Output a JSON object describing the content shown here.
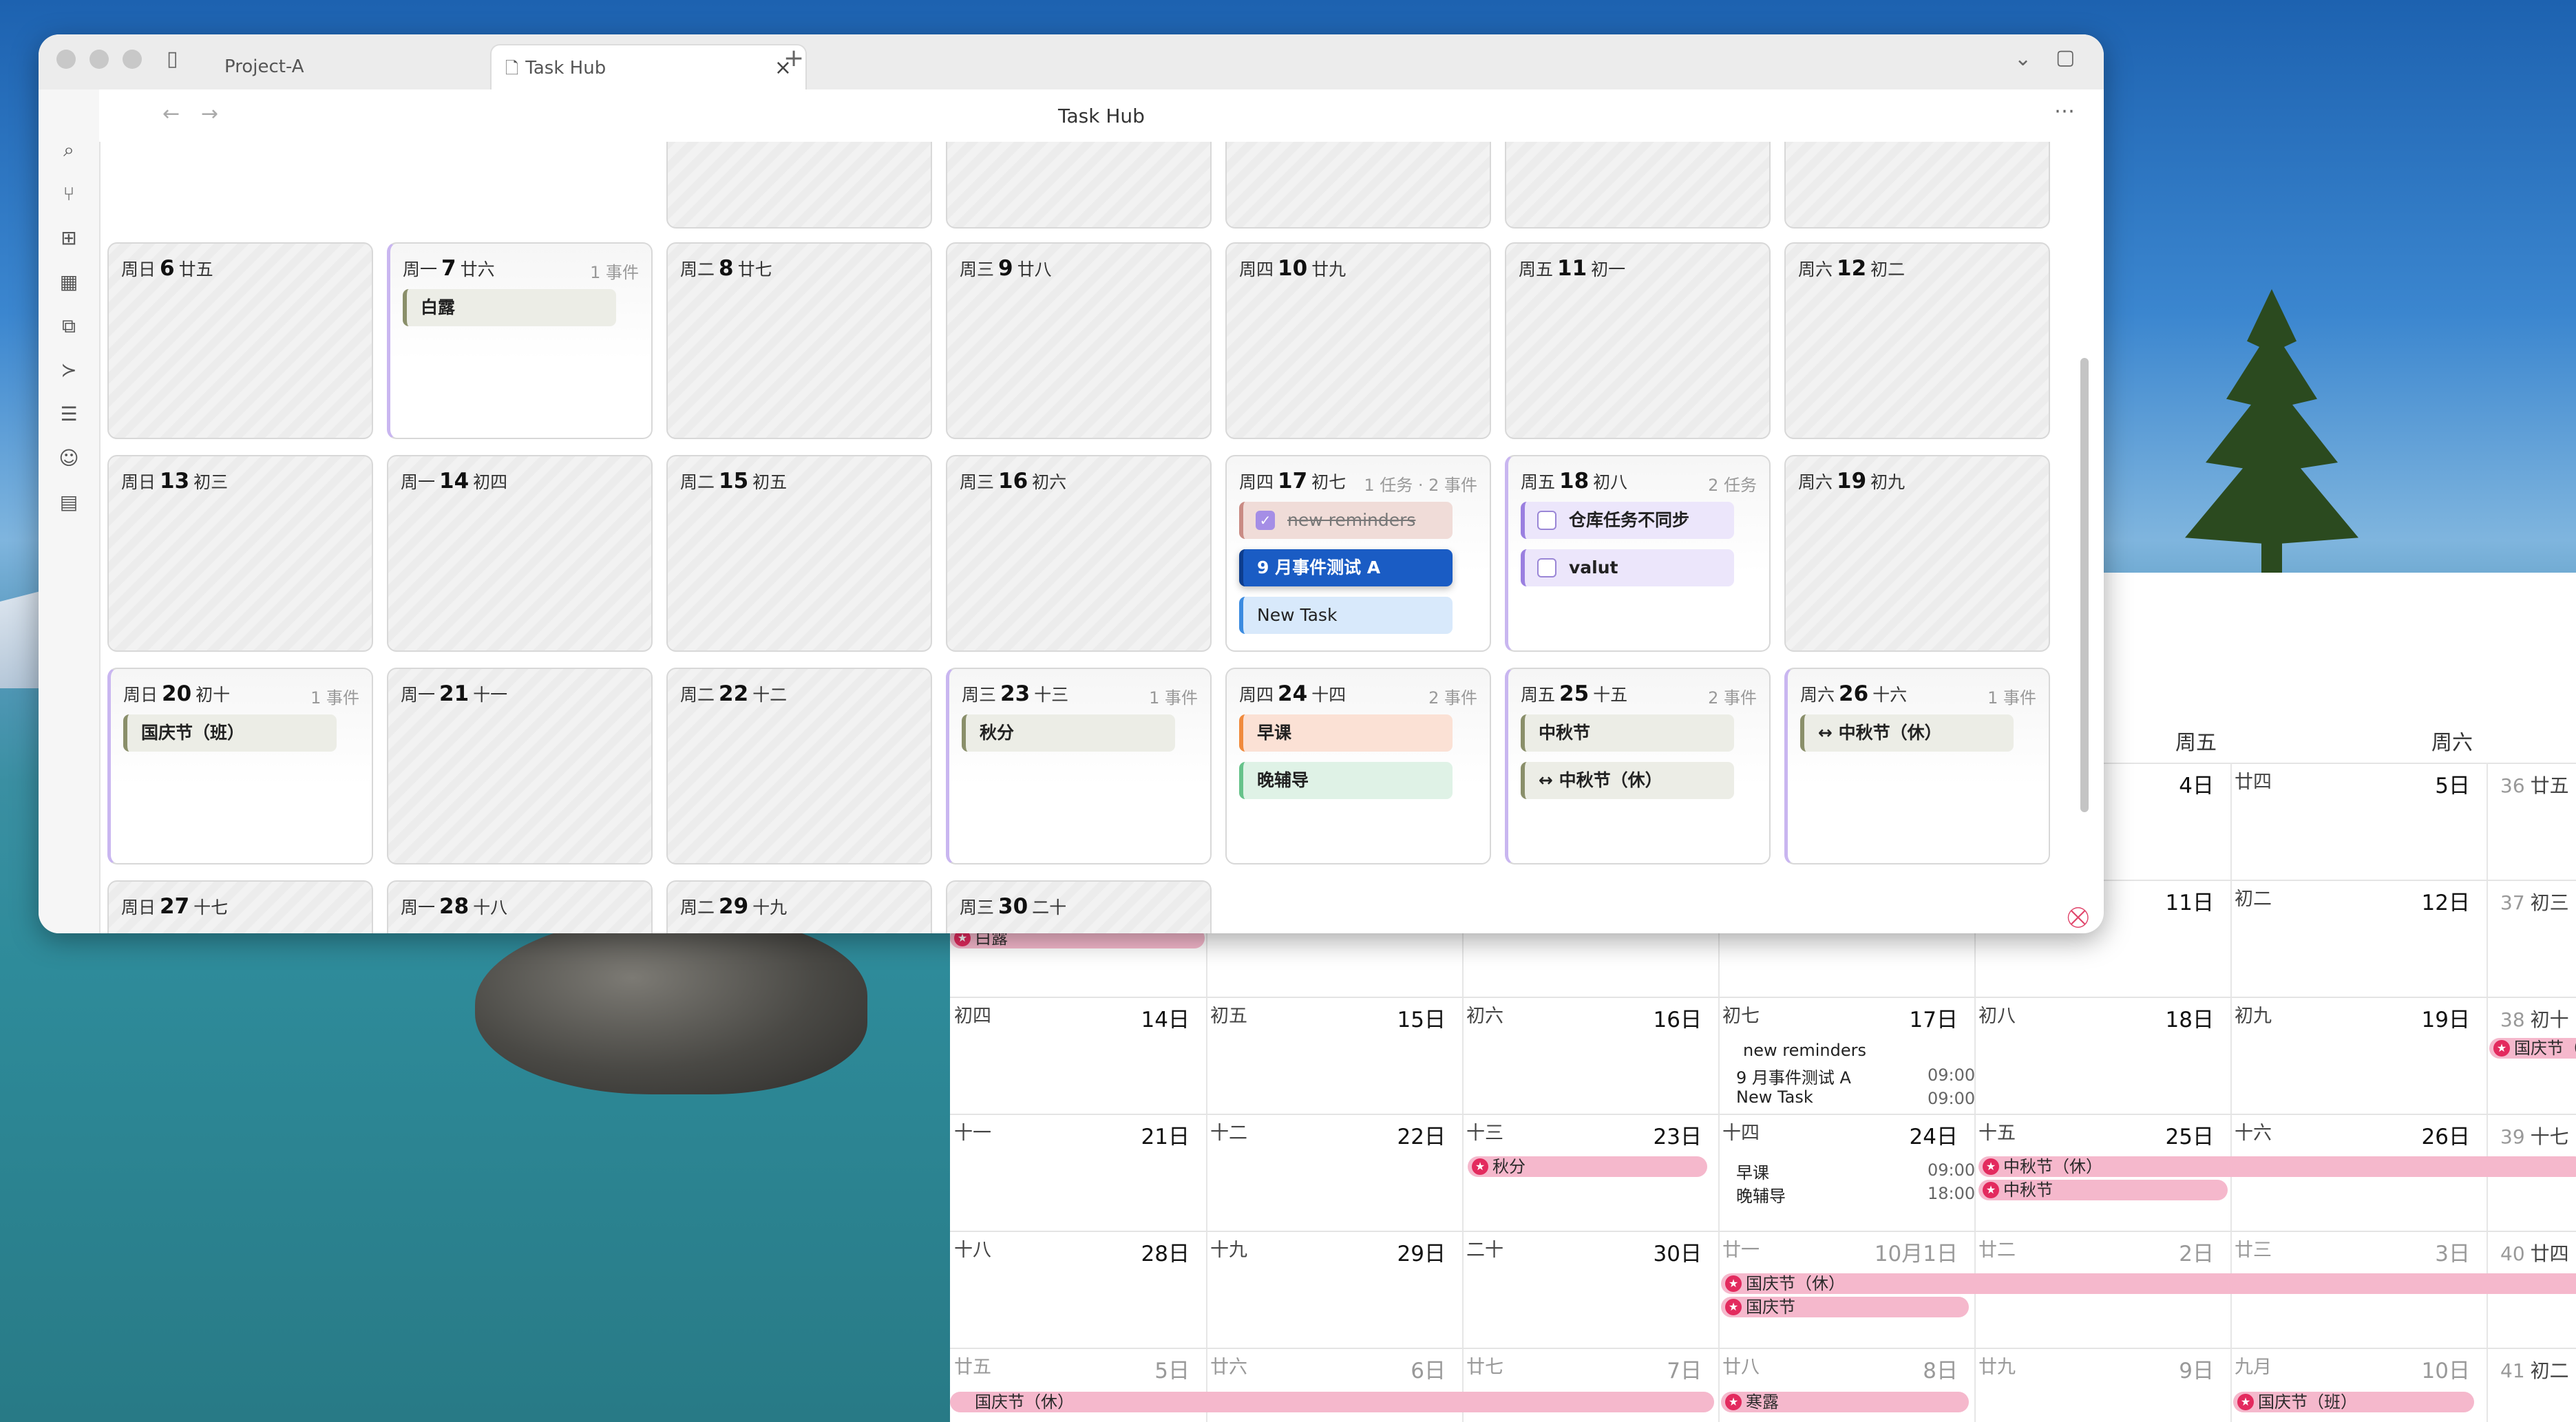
{
  "window": {
    "tabs": [
      {
        "label": "Project-A"
      },
      {
        "label": "Task Hub"
      }
    ],
    "title": "Task Hub"
  },
  "grid": {
    "weeks": [
      [
        {
          "weekday": "周日",
          "day": "6",
          "lunar": "廿五",
          "count": "",
          "events": []
        },
        {
          "weekday": "周一",
          "day": "7",
          "lunar": "廿六",
          "count": "1 事件",
          "events": [
            {
              "label": "白露",
              "kind": "g"
            }
          ]
        },
        {
          "weekday": "周二",
          "day": "8",
          "lunar": "廿七",
          "count": "",
          "events": []
        },
        {
          "weekday": "周三",
          "day": "9",
          "lunar": "廿八",
          "count": "",
          "events": []
        },
        {
          "weekday": "周四",
          "day": "10",
          "lunar": "廿九",
          "count": "",
          "events": []
        },
        {
          "weekday": "周五",
          "day": "11",
          "lunar": "初一",
          "count": "",
          "events": []
        },
        {
          "weekday": "周六",
          "day": "12",
          "lunar": "初二",
          "count": "",
          "events": []
        }
      ],
      [
        {
          "weekday": "周日",
          "day": "13",
          "lunar": "初三",
          "count": "",
          "events": []
        },
        {
          "weekday": "周一",
          "day": "14",
          "lunar": "初四",
          "count": "",
          "events": []
        },
        {
          "weekday": "周二",
          "day": "15",
          "lunar": "初五",
          "count": "",
          "events": []
        },
        {
          "weekday": "周三",
          "day": "16",
          "lunar": "初六",
          "count": "",
          "events": []
        },
        {
          "weekday": "周四",
          "day": "17",
          "lunar": "初七",
          "count": "1 任务 · 2 事件",
          "events": [
            {
              "label": "new reminders",
              "kind": "rd"
            },
            {
              "label": "9 月事件测试 A",
              "kind": "b"
            },
            {
              "label": "New Task",
              "kind": "lb"
            }
          ]
        },
        {
          "weekday": "周五",
          "day": "18",
          "lunar": "初八",
          "count": "2 任务",
          "events": [
            {
              "label": "仓库任务不同步",
              "kind": "pu"
            },
            {
              "label": "valut",
              "kind": "pu"
            }
          ]
        },
        {
          "weekday": "周六",
          "day": "19",
          "lunar": "初九",
          "count": "",
          "events": []
        }
      ],
      [
        {
          "weekday": "周日",
          "day": "20",
          "lunar": "初十",
          "count": "1 事件",
          "events": [
            {
              "label": "国庆节（班）",
              "kind": "g"
            }
          ]
        },
        {
          "weekday": "周一",
          "day": "21",
          "lunar": "十一",
          "count": "",
          "events": []
        },
        {
          "weekday": "周二",
          "day": "22",
          "lunar": "十二",
          "count": "",
          "events": []
        },
        {
          "weekday": "周三",
          "day": "23",
          "lunar": "十三",
          "count": "1 事件",
          "events": [
            {
              "label": "秋分",
              "kind": "g"
            }
          ]
        },
        {
          "weekday": "周四",
          "day": "24",
          "lunar": "十四",
          "count": "2 事件",
          "events": [
            {
              "label": "早课",
              "kind": "o"
            },
            {
              "label": "晚辅导",
              "kind": "gr"
            }
          ]
        },
        {
          "weekday": "周五",
          "day": "25",
          "lunar": "十五",
          "count": "2 事件",
          "events": [
            {
              "label": "中秋节",
              "kind": "g"
            },
            {
              "label": "↔ 中秋节（休）",
              "kind": "g"
            }
          ]
        },
        {
          "weekday": "周六",
          "day": "26",
          "lunar": "十六",
          "count": "1 事件",
          "events": [
            {
              "label": "↔ 中秋节（休）",
              "kind": "g"
            }
          ]
        }
      ],
      [
        {
          "weekday": "周日",
          "day": "27",
          "lunar": "十七",
          "count": "",
          "events": []
        },
        {
          "weekday": "周一",
          "day": "28",
          "lunar": "十八",
          "count": "",
          "events": []
        },
        {
          "weekday": "周二",
          "day": "29",
          "lunar": "十九",
          "count": "",
          "events": []
        },
        {
          "weekday": "周三",
          "day": "30",
          "lunar": "二十",
          "count": "",
          "events": []
        }
      ]
    ]
  },
  "background_calendar": {
    "headers": [
      "周五",
      "周六"
    ],
    "week_numbers": [
      "36",
      "37",
      "38",
      "39",
      "40",
      "41"
    ],
    "week_lunar": [
      "廿五",
      "初三",
      "初十",
      "十七",
      "廿四",
      "初二"
    ],
    "rows": [
      [
        {
          "lunar": "",
          "day": ""
        },
        {
          "lunar": "",
          "day": ""
        },
        {
          "lunar": "",
          "day": ""
        },
        {
          "lunar": "",
          "day": "4日"
        },
        {
          "lunar": "廿四",
          "day": "5日"
        }
      ],
      [
        {
          "lunar": "",
          "day": ""
        },
        {
          "lunar": "",
          "day": ""
        },
        {
          "lunar": "",
          "day": ""
        },
        {
          "lunar": "",
          "day": "11日"
        },
        {
          "lunar": "初二",
          "day": "12日"
        }
      ],
      [
        {
          "lunar": "初四",
          "day": "14日"
        },
        {
          "lunar": "初五",
          "day": "15日"
        },
        {
          "lunar": "初六",
          "day": "16日"
        },
        {
          "lunar": "初七",
          "day": "17日"
        },
        {
          "lunar": "初八",
          "day": "18日"
        },
        {
          "lunar": "初九",
          "day": "19日"
        }
      ],
      [
        {
          "lunar": "十一",
          "day": "21日"
        },
        {
          "lunar": "十二",
          "day": "22日"
        },
        {
          "lunar": "十三",
          "day": "23日"
        },
        {
          "lunar": "十四",
          "day": "24日"
        },
        {
          "lunar": "十五",
          "day": "25日"
        },
        {
          "lunar": "十六",
          "day": "26日"
        }
      ],
      [
        {
          "lunar": "十八",
          "day": "28日"
        },
        {
          "lunar": "十九",
          "day": "29日"
        },
        {
          "lunar": "二十",
          "day": "30日"
        },
        {
          "lunar": "廿一",
          "day": "10月1日"
        },
        {
          "lunar": "廿二",
          "day": "2日"
        },
        {
          "lunar": "廿三",
          "day": "3日"
        }
      ],
      [
        {
          "lunar": "廿五",
          "day": "5日"
        },
        {
          "lunar": "廿六",
          "day": "6日"
        },
        {
          "lunar": "廿七",
          "day": "7日"
        },
        {
          "lunar": "廿八",
          "day": "8日"
        },
        {
          "lunar": "廿九",
          "day": "9日"
        },
        {
          "lunar": "九月",
          "day": "10日"
        }
      ]
    ],
    "events": {
      "new_reminders": "new reminders",
      "event_a": "9 月事件测试 A",
      "event_a_time": "09:00",
      "new_task": "New Task",
      "new_task_time": "09:00",
      "qiufen": "秋分",
      "zaoke": "早课",
      "zaoke_time": "09:00",
      "wanfudao": "晚辅导",
      "wanfudao_time": "18:00",
      "zhongqiu_xiu": "中秋节（休）",
      "zhongqiu": "中秋节",
      "guoqing_xiu": "国庆节（休）",
      "guoqing": "国庆节",
      "guoqing_xiu2": "国庆节（休）",
      "hanlu": "寒露",
      "guoqing_ban": "国庆节（班）",
      "guoqing_ban2": "国庆节（班）",
      "bailu": "白露"
    }
  }
}
